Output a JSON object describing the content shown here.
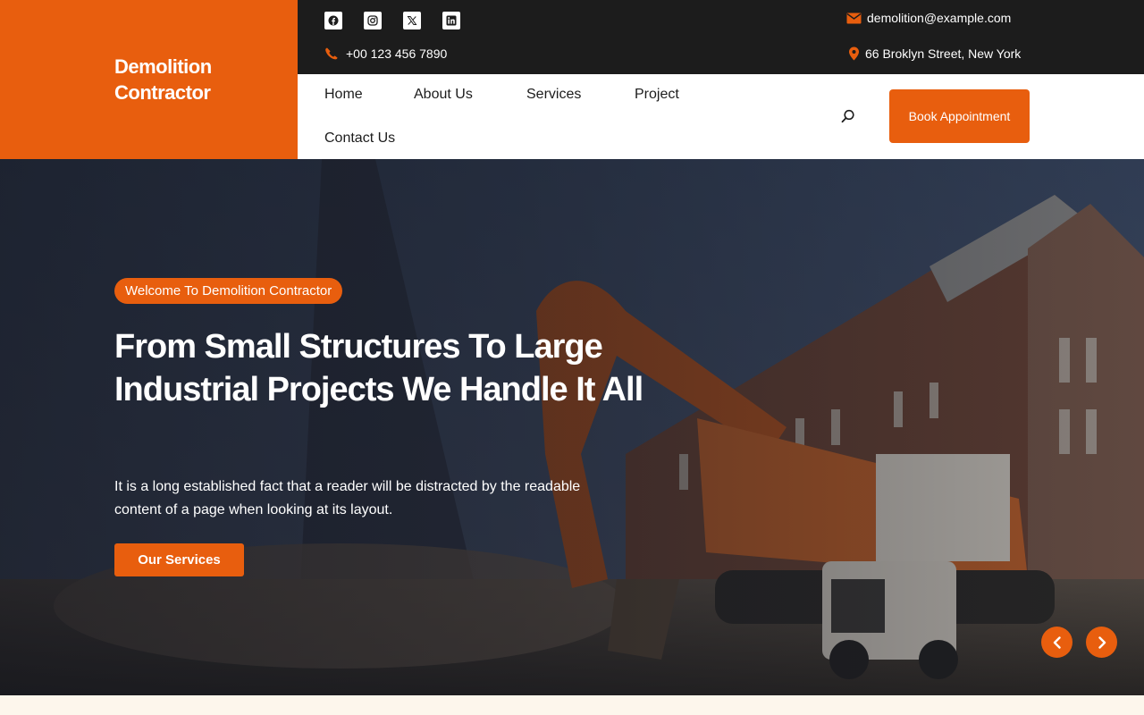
{
  "brand": {
    "name": "Demolition Contractor",
    "color": "#e85e0e"
  },
  "topbar": {
    "social": [
      "facebook-icon",
      "instagram-icon",
      "x-icon",
      "linkedin-icon"
    ],
    "phone": "+00 123 456 7890",
    "email": "demolition@example.com",
    "address": "66 Broklyn Street, New York"
  },
  "nav": {
    "links": [
      "Home",
      "About Us",
      "Services",
      "Project",
      "Contact Us"
    ],
    "cta": "Book Appointment"
  },
  "hero": {
    "badge": "Welcome To Demolition Contractor",
    "title": "From Small Structures To Large Industrial Projects We Handle It All",
    "subtitle": "It is a long established fact that a reader will be distracted by the readable content of a page when looking at its layout.",
    "button": "Our Services"
  },
  "colors": {
    "accent": "#e85e0e",
    "dark": "#1c1c1c"
  }
}
